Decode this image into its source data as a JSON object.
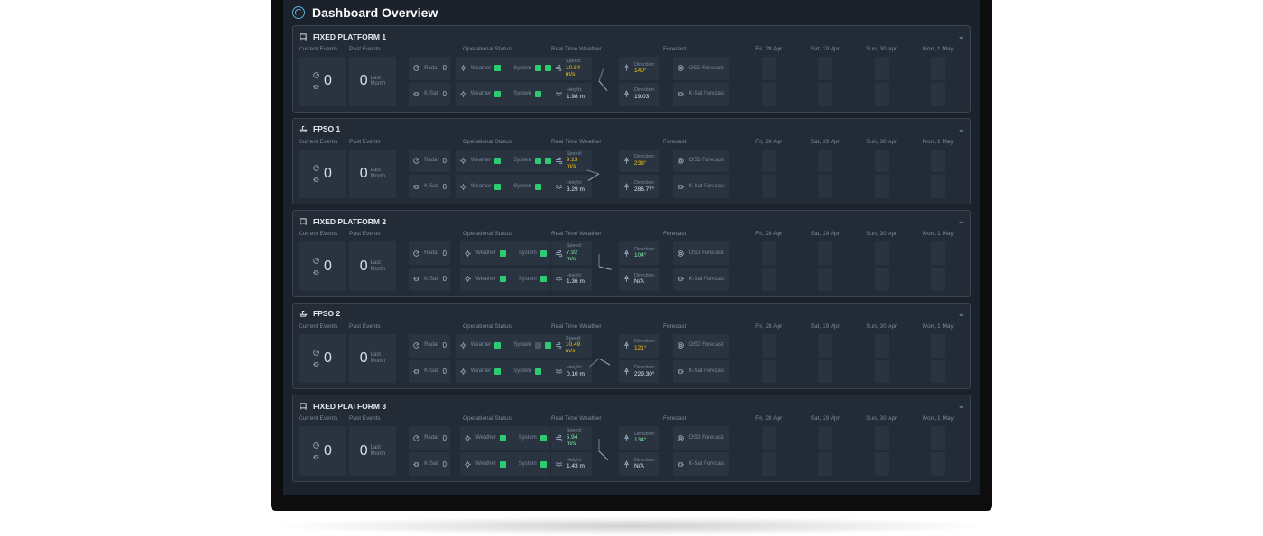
{
  "app": {
    "title": "Dashboard Overview"
  },
  "columns": {
    "current_events": "Current Events",
    "past_events": "Past Events",
    "operational_status": "Operational Status",
    "rtw": "Real Time Weather",
    "forecast": "Forecast"
  },
  "sensors": {
    "radar": "Radar",
    "ksat": "K-Sat",
    "weather": "Weather",
    "system": "System"
  },
  "rtw_labels": {
    "speed": "Speed:",
    "height": "Height:",
    "direction": "Direction:"
  },
  "forecast_sources": {
    "osd": "OSD Forecast",
    "ksat": "K-Sat Forecast"
  },
  "forecast_days": [
    "Fri, 28 Apr",
    "Sat, 29 Apr",
    "Sun, 30 Apr",
    "Mon, 1 May"
  ],
  "past_label": "Last Month",
  "zero": "0",
  "platforms": [
    {
      "name": "FIXED PLATFORM 1",
      "icon": "platform",
      "current": 0,
      "past": 0,
      "radar": 0,
      "ksat_count": 0,
      "status_rows": [
        {
          "weather": [
            "g"
          ],
          "system": [
            "g",
            "g"
          ]
        },
        {
          "weather": [
            "g"
          ],
          "system": [
            "g"
          ]
        }
      ],
      "rtw": {
        "speed": {
          "val": "10.84 m/s",
          "cls": "val-y"
        },
        "height": {
          "val": "1.98 m",
          "cls": "val-w"
        },
        "dir1": {
          "val": "140°",
          "cls": "val-y"
        },
        "dir2": {
          "val": "19.03°",
          "cls": "val-w"
        },
        "angles": [
          140,
          19
        ]
      },
      "heat": {
        "osd": [
          [
            "r",
            "r",
            "r",
            "r",
            "r",
            "r"
          ],
          [
            "r",
            "o",
            "o",
            "o",
            "o",
            "o",
            "o",
            "o",
            "r",
            "o",
            "o",
            "o",
            "o",
            "o",
            "o",
            "o"
          ],
          [
            "g",
            "g",
            "g",
            "g",
            "g",
            "g",
            "g",
            "g",
            "g",
            "g",
            "g",
            "g",
            "g",
            "g",
            "g",
            "g"
          ],
          [
            "r",
            "r",
            "o",
            "o",
            "o",
            "o",
            "o",
            "o",
            "g",
            "g",
            "o",
            "o",
            "o",
            "o",
            "g",
            "g"
          ]
        ],
        "ksat": [
          [
            "r",
            "r",
            "r",
            "r",
            "r",
            "r"
          ],
          [
            "r",
            "o",
            "o",
            "o",
            "o",
            "o",
            "o",
            "o",
            "o",
            "o",
            "o",
            "o",
            "o",
            "o",
            "o",
            "o"
          ],
          [
            "g",
            "g",
            "g",
            "g",
            "g",
            "g",
            "g",
            "g",
            "g",
            "g",
            "g",
            "g",
            "g",
            "g",
            "g",
            "g"
          ],
          [
            "o",
            "o",
            "o",
            "o",
            "o",
            "o",
            "o",
            "g",
            "g",
            "g",
            "g",
            "g",
            "o",
            "o",
            "o",
            "r"
          ]
        ]
      }
    },
    {
      "name": "FPSO 1",
      "icon": "fpso",
      "current": 0,
      "past": 0,
      "radar": 0,
      "ksat_count": 0,
      "status_rows": [
        {
          "weather": [
            "g"
          ],
          "system": [
            "g",
            "g"
          ]
        },
        {
          "weather": [
            "g"
          ],
          "system": [
            "g"
          ]
        }
      ],
      "rtw": {
        "speed": {
          "val": "9.13 m/s",
          "cls": "val-y"
        },
        "height": {
          "val": "3.29 m",
          "cls": "val-w"
        },
        "dir1": {
          "val": "238°",
          "cls": "val-y"
        },
        "dir2": {
          "val": "286.77°",
          "cls": "val-w"
        },
        "angles": [
          238,
          287
        ]
      },
      "heat": {
        "osd": [
          [
            "g",
            "o",
            "o",
            "g",
            "g",
            "g"
          ],
          [
            "g",
            "g",
            "g",
            "g",
            "g",
            "g",
            "g",
            "g",
            "g",
            "g",
            "g",
            "g",
            "g",
            "g",
            "g",
            "g"
          ],
          [
            "g",
            "g",
            "g",
            "g",
            "g",
            "g",
            "g",
            "g",
            "g",
            "o",
            "g",
            "g",
            "g",
            "g",
            "g",
            "g"
          ],
          [
            "o",
            "o",
            "o",
            "o",
            "o",
            "o",
            "o",
            "o",
            "o",
            "o",
            "g",
            "o",
            "o",
            "o",
            "o",
            "o"
          ]
        ],
        "ksat": [
          [
            "g",
            "o",
            "o",
            "g",
            "g",
            "g"
          ],
          [
            "g",
            "g",
            "g",
            "g",
            "g",
            "g",
            "g",
            "g",
            "g",
            "g",
            "g",
            "g",
            "g",
            "g",
            "o",
            "o"
          ],
          [
            "g",
            "o",
            "g",
            "g",
            "g",
            "g",
            "g",
            "g",
            "g",
            "g",
            "g",
            "g",
            "o",
            "g",
            "g",
            "g"
          ],
          [
            "o",
            "o",
            "o",
            "o",
            "o",
            "o",
            "o",
            "o",
            "o",
            "o",
            "o",
            "o",
            "o",
            "o",
            "o",
            "o"
          ]
        ]
      }
    },
    {
      "name": "FIXED PLATFORM 2",
      "icon": "platform",
      "current": 0,
      "past": 0,
      "radar": 0,
      "ksat_count": 0,
      "status_rows": [
        {
          "weather": [
            "g"
          ],
          "system": [
            "g"
          ]
        },
        {
          "weather": [
            "g"
          ],
          "system": [
            "g"
          ]
        }
      ],
      "rtw": {
        "speed": {
          "val": "7.92 m/s",
          "cls": "val-g"
        },
        "height": {
          "val": "1.36 m",
          "cls": "val-w"
        },
        "dir1": {
          "val": "104°",
          "cls": "val-g"
        },
        "dir2": {
          "val": "N/A",
          "cls": "val-w"
        },
        "angles": [
          104,
          0
        ]
      },
      "heat": {
        "osd": [
          [
            "g",
            "g",
            "g",
            "g",
            "g",
            "g"
          ],
          [
            "g",
            "g",
            "g",
            "g",
            "g",
            "g",
            "g",
            "g",
            "g",
            "g",
            "g",
            "g",
            "g",
            "g",
            "g",
            "g"
          ],
          [
            "g",
            "g",
            "g",
            "g",
            "o",
            "g",
            "g",
            "g",
            "g",
            "g",
            "g",
            "g",
            "g",
            "g",
            "g",
            "g"
          ],
          [
            "g",
            "g",
            "g",
            "g",
            "g",
            "g",
            "g",
            "g",
            "o",
            "g",
            "o",
            "o",
            "o",
            "o",
            "o",
            "o"
          ]
        ],
        "ksat": [
          [
            "g",
            "g",
            "g",
            "g",
            "g",
            "g"
          ],
          [
            "g",
            "g",
            "g",
            "g",
            "g",
            "g",
            "g",
            "g",
            "g",
            "g",
            "g",
            "g",
            "g",
            "g",
            "g",
            "g"
          ],
          [
            "g",
            "g",
            "g",
            "g",
            "g",
            "g",
            "g",
            "g",
            "g",
            "g",
            "g",
            "g",
            "g",
            "g",
            "o",
            "o"
          ],
          [
            "g",
            "g",
            "g",
            "g",
            "g",
            "g",
            "o",
            "o",
            "o",
            "o",
            "o",
            "o",
            "o",
            "o",
            "o",
            "o"
          ]
        ]
      }
    },
    {
      "name": "FPSO 2",
      "icon": "fpso",
      "current": 0,
      "past": 0,
      "radar": 0,
      "ksat_count": 0,
      "status_rows": [
        {
          "weather": [
            "g"
          ],
          "system": [
            "d",
            "g"
          ]
        },
        {
          "weather": [
            "g"
          ],
          "system": [
            "g"
          ]
        }
      ],
      "rtw": {
        "speed": {
          "val": "10.49 m/s",
          "cls": "val-y"
        },
        "height": {
          "val": "0.10 m",
          "cls": "val-w"
        },
        "dir1": {
          "val": "121°",
          "cls": "val-y"
        },
        "dir2": {
          "val": "229.30°",
          "cls": "val-w"
        },
        "angles": [
          121,
          229
        ]
      },
      "heat": {
        "osd": [
          [
            "o",
            "g",
            "g",
            "o",
            "g",
            "g"
          ],
          [
            "g",
            "g",
            "g",
            "g",
            "g",
            "g",
            "g",
            "g",
            "g",
            "g",
            "g",
            "g",
            "g",
            "g",
            "g",
            "g"
          ],
          [
            "g",
            "g",
            "g",
            "g",
            "g",
            "g",
            "g",
            "g",
            "g",
            "g",
            "g",
            "g",
            "o",
            "o",
            "o",
            "o"
          ],
          [
            "o",
            "o",
            "o",
            "o",
            "o",
            "o",
            "o",
            "o",
            "g",
            "g",
            "o",
            "o",
            "o",
            "o",
            "o",
            "o"
          ]
        ],
        "ksat": [
          [
            "o",
            "o",
            "o",
            "g",
            "g",
            "g"
          ],
          [
            "g",
            "g",
            "g",
            "g",
            "g",
            "g",
            "g",
            "g",
            "g",
            "g",
            "g",
            "g",
            "g",
            "g",
            "g",
            "g"
          ],
          [
            "g",
            "g",
            "g",
            "g",
            "g",
            "g",
            "g",
            "g",
            "g",
            "g",
            "o",
            "o",
            "o",
            "o",
            "o",
            "o"
          ],
          [
            "o",
            "o",
            "o",
            "o",
            "o",
            "o",
            "o",
            "o",
            "o",
            "o",
            "o",
            "o",
            "o",
            "o",
            "o",
            "o"
          ]
        ]
      }
    },
    {
      "name": "FIXED PLATFORM 3",
      "icon": "platform",
      "current": 0,
      "past": 0,
      "radar": 0,
      "ksat_count": 0,
      "status_rows": [
        {
          "weather": [
            "g"
          ],
          "system": [
            "g"
          ]
        },
        {
          "weather": [
            "g"
          ],
          "system": [
            "g"
          ]
        }
      ],
      "rtw": {
        "speed": {
          "val": "5.94 m/s",
          "cls": "val-g"
        },
        "height": {
          "val": "1.43 m",
          "cls": "val-w"
        },
        "dir1": {
          "val": "134°",
          "cls": "val-g"
        },
        "dir2": {
          "val": "N/A",
          "cls": "val-w"
        },
        "angles": [
          134,
          0
        ]
      },
      "heat": {
        "osd": [
          [
            "g",
            "g",
            "g",
            "g",
            "g",
            "g"
          ],
          [
            "g",
            "g",
            "g",
            "g",
            "g",
            "g",
            "g",
            "g",
            "g",
            "g",
            "g",
            "g",
            "g",
            "g",
            "g",
            "g"
          ],
          [
            "g",
            "g",
            "r",
            "r",
            "g",
            "g",
            "g",
            "g",
            "g",
            "g",
            "g",
            "g",
            "g",
            "g",
            "g",
            "g"
          ],
          [
            "g",
            "g",
            "g",
            "g",
            "g",
            "g",
            "g",
            "g",
            "g",
            "g",
            "g",
            "g",
            "g",
            "g",
            "g",
            "g"
          ]
        ],
        "ksat": [
          [
            "g",
            "g",
            "g",
            "g",
            "g",
            "g"
          ],
          [
            "g",
            "g",
            "g",
            "g",
            "g",
            "g",
            "g",
            "g",
            "g",
            "g",
            "g",
            "g",
            "g",
            "g",
            "g",
            "g"
          ],
          [
            "g",
            "g",
            "g",
            "g",
            "g",
            "g",
            "g",
            "g",
            "g",
            "g",
            "g",
            "g",
            "g",
            "g",
            "g",
            "g"
          ],
          [
            "g",
            "g",
            "g",
            "g",
            "g",
            "g",
            "g",
            "g",
            "g",
            "g",
            "g",
            "g",
            "g",
            "g",
            "g",
            "g"
          ]
        ]
      }
    }
  ]
}
